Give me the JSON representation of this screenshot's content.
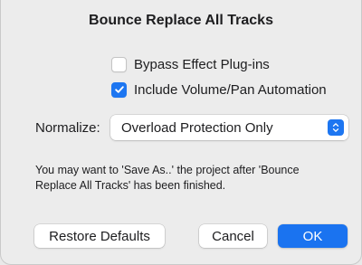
{
  "dialog": {
    "title": "Bounce Replace All Tracks",
    "options": [
      {
        "label": "Bypass Effect Plug-ins",
        "checked": false
      },
      {
        "label": "Include Volume/Pan Automation",
        "checked": true
      }
    ],
    "normalize": {
      "label": "Normalize:",
      "selected": "Overload Protection Only"
    },
    "note": "You may want to 'Save As..' the project after 'Bounce Replace All Tracks' has been finished.",
    "buttons": {
      "restore_defaults": "Restore Defaults",
      "cancel": "Cancel",
      "ok": "OK"
    },
    "colors": {
      "accent": "#1a73f0",
      "background": "#ececec"
    },
    "icons": {
      "checkbox_checked": "checkmark-icon",
      "select": "chevron-up-down-icon"
    }
  }
}
